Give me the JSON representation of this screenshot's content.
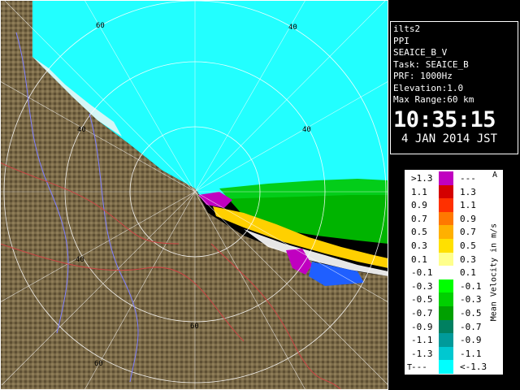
{
  "info": {
    "site": "ilts2",
    "mode": "PPI",
    "product": "SEAICE_B_V",
    "task": "Task: SEAICE_B",
    "prf": "PRF: 1000Hz",
    "elevation": "Elevation:1.0",
    "max_range": "Max Range:60 km",
    "time": "10:35:15",
    "date": "4 JAN 2014 JST"
  },
  "legend": {
    "title": "Mean Velocity in m/s",
    "corner_top": "A",
    "corner_bottom": "T",
    "rows": [
      {
        "left": ">1.3",
        "right": "---",
        "color": "#c000c0"
      },
      {
        "left": "1.1",
        "right": "1.3",
        "color": "#d40000"
      },
      {
        "left": "0.9",
        "right": "1.1",
        "color": "#ff3000"
      },
      {
        "left": "0.7",
        "right": "0.9",
        "color": "#ff7800"
      },
      {
        "left": "0.5",
        "right": "0.7",
        "color": "#ffb000"
      },
      {
        "left": "0.3",
        "right": "0.5",
        "color": "#ffe000"
      },
      {
        "left": "0.1",
        "right": "0.3",
        "color": "#ffff8c"
      },
      {
        "left": "-0.1",
        "right": "0.1",
        "color": "#ffffff"
      },
      {
        "left": "-0.3",
        "right": "-0.1",
        "color": "#00ff00"
      },
      {
        "left": "-0.5",
        "right": "-0.3",
        "color": "#00d000"
      },
      {
        "left": "-0.7",
        "right": "-0.5",
        "color": "#00a000"
      },
      {
        "left": "-0.9",
        "right": "-0.7",
        "color": "#008060"
      },
      {
        "left": "-1.1",
        "right": "-0.9",
        "color": "#009a9a"
      },
      {
        "left": "-1.3",
        "right": "-1.1",
        "color": "#00c8d0"
      },
      {
        "left": "---",
        "right": "<-1.3",
        "color": "#00ffff"
      }
    ]
  },
  "range_labels": [
    "60",
    "40",
    "40",
    "40",
    "40",
    "60",
    "60"
  ],
  "colors": {
    "land": "#7a6a48",
    "sea_echo": "#22ffff",
    "rings": "#ffffff",
    "background": "#000000"
  }
}
